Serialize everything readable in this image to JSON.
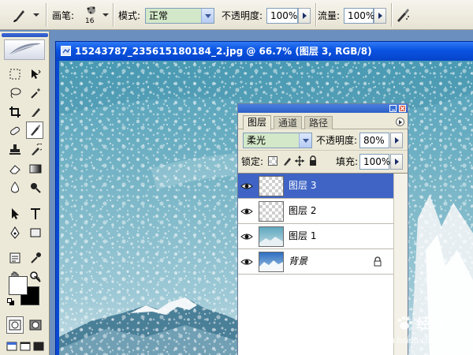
{
  "options_bar": {
    "brush_label": "画笔:",
    "brush_size": "16",
    "mode_label": "模式:",
    "mode_value": "正常",
    "opacity_label": "不透明度:",
    "opacity_value": "100%",
    "flow_label": "流量:",
    "flow_value": "100%"
  },
  "document": {
    "title": "15243787_235615180184_2.jpg @ 66.7% (图层 3, RGB/8)"
  },
  "layers_panel": {
    "tabs": [
      {
        "label": "图层",
        "active": true
      },
      {
        "label": "通道",
        "active": false
      },
      {
        "label": "路径",
        "active": false
      }
    ],
    "blend_mode": "柔光",
    "opacity_label": "不透明度:",
    "opacity_value": "80%",
    "lock_label": "锁定:",
    "fill_label": "填充:",
    "fill_value": "100%",
    "layers": [
      {
        "name": "图层 3",
        "selected": true
      },
      {
        "name": "图层 2",
        "selected": false
      },
      {
        "name": "图层 1",
        "selected": false
      },
      {
        "name": "背景",
        "selected": false,
        "locked": true
      }
    ]
  },
  "watermark": {
    "brand": "Bai",
    "brand_cn": "经验",
    "url": "jingyan.baidu.com"
  },
  "colors": {
    "selection": "#3f64c6",
    "title_bar": "#0a52e1",
    "panel_bg": "#ece9d8"
  }
}
